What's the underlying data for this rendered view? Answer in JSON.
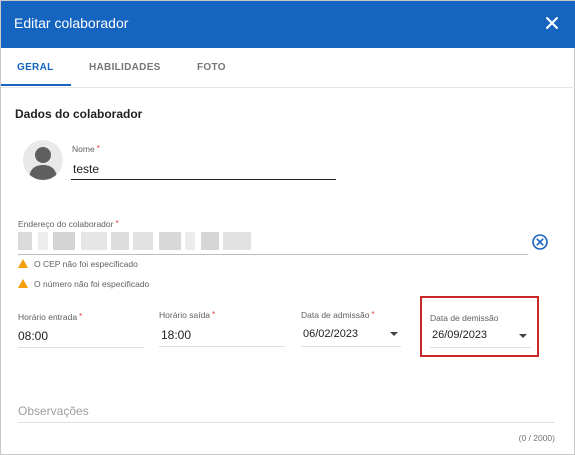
{
  "dialog": {
    "title": "Editar colaborador"
  },
  "tabs": [
    {
      "label": "GERAL",
      "active": true
    },
    {
      "label": "HABILIDADES",
      "active": false
    },
    {
      "label": "FOTO",
      "active": false
    }
  ],
  "section": {
    "title": "Dados do colaborador"
  },
  "fields": {
    "nome": {
      "label": "Nome",
      "value": "teste",
      "required": "*"
    },
    "endereco": {
      "label": "Endereço do colaborador",
      "required": "*"
    },
    "horario_entrada": {
      "label": "Horário entrada",
      "value": "08:00",
      "required": "*"
    },
    "horario_saida": {
      "label": "Horário saída",
      "value": "18:00",
      "required": "*"
    },
    "data_admissao": {
      "label": "Data de admissão",
      "value": "06/02/2023",
      "required": "*"
    },
    "data_demissao": {
      "label": "Data de demissão",
      "value": "26/09/2023"
    },
    "observacoes": {
      "placeholder": "Observações",
      "counter": "(0 / 2000)"
    }
  },
  "warnings": [
    "O CEP não foi especificado",
    "O número não foi especificado"
  ],
  "colors": {
    "primary": "#1565c0",
    "warning": "#f59e0b",
    "highlight": "#c62828",
    "required": "#e53935"
  },
  "icons": {
    "close": "close-icon",
    "avatar": "person-avatar-icon",
    "clear": "clear-circle-icon",
    "warning": "warning-triangle-icon",
    "dropdown": "chevron-down-icon"
  }
}
